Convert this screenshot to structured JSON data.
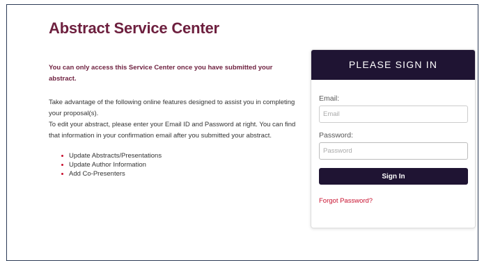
{
  "page": {
    "title": "Abstract Service Center"
  },
  "content": {
    "notice": "You can only access this Service Center once you have submitted your abstract.",
    "intro_1": "Take advantage of the following online features designed to assist you in completing your proposal(s).",
    "intro_2": "To edit your abstract, please enter your Email ID and Password at right. You can find that information in your confirmation email after you submitted your abstract.",
    "features": [
      "Update Abstracts/Presentations",
      "Update Author Information",
      "Add Co-Presenters"
    ]
  },
  "signin": {
    "header": "PLEASE SIGN IN",
    "email_label": "Email:",
    "email_placeholder": "Email",
    "email_value": "",
    "password_label": "Password:",
    "password_placeholder": "Password",
    "password_value": "",
    "button_label": "Sign In",
    "forgot_label": "Forgot Password?"
  },
  "colors": {
    "title": "#6d1f3e",
    "panel_header": "#1f1433",
    "accent": "#c8102e"
  }
}
